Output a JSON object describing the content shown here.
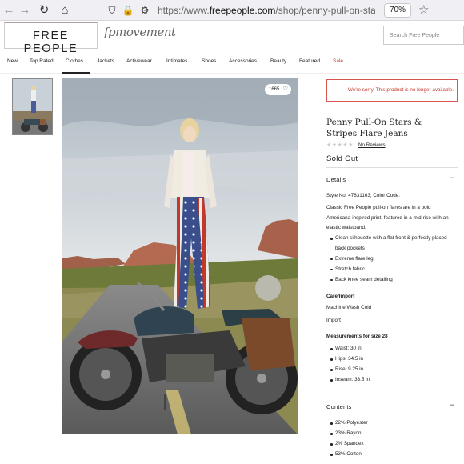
{
  "browser": {
    "url_prefix": "https://www.",
    "url_domain": "freepeople.com",
    "url_path": "/shop/penny-pull-on-stars-st",
    "zoom": "70%",
    "icons": [
      "back-arrow-icon",
      "forward-arrow-icon",
      "reload-icon",
      "home-icon",
      "shield-icon",
      "lock-icon",
      "permissions-icon",
      "bookmark-star-icon"
    ]
  },
  "header": {
    "logo": "FREE PEOPLE",
    "sub_brand": "fpmovement",
    "search_placeholder": "Search Free People"
  },
  "nav": {
    "items": [
      "New",
      "Top Rated",
      "Clothes",
      "Jackets",
      "Activewear",
      "Intimates",
      "Shoes",
      "Accessories",
      "Beauty",
      "Featured",
      "Sale"
    ],
    "active": "Clothes",
    "sale_color": "#c0392b"
  },
  "gallery": {
    "likes": "1665"
  },
  "product": {
    "notice": "We're sorry. This product is no longer available.",
    "name": "Penny Pull-On Stars & Stripes Flare Jeans",
    "reviews_label": "No Reviews",
    "rating": 0,
    "rating_max": 5,
    "status": "Sold Out",
    "details": {
      "title": "Details",
      "style_no": "Style No. 47631163; Color Code:",
      "description": "Classic Free People pull-on flares are in a bold Americana-inspired print, featured in a mid-rise with an elastic waistband.",
      "features": [
        "Clean silhouette with a flat front & perfectly placed back pockets",
        "Extreme flare leg",
        "Stretch fabric",
        "Back knee seam detailing"
      ],
      "care_title": "Care/Import",
      "care": "Machine Wash Cold",
      "import": "Import",
      "measure_title": "Measurements for size 28",
      "measurements": [
        "Waist: 30 in",
        "Hips: 34.5 in",
        "Rise: 9.25 in",
        "Inseam: 33.5 in"
      ]
    },
    "contents": {
      "title": "Contents",
      "items": [
        "22% Polyester",
        "23% Rayon",
        "2% Spandex",
        "53% Cotton"
      ]
    }
  }
}
